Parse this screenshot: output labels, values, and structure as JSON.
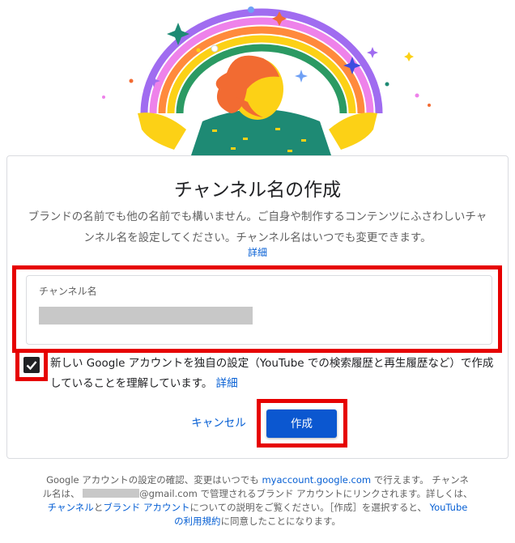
{
  "dialog": {
    "title": "チャンネル名の作成",
    "description": "ブランドの名前でも他の名前でも構いません。ご自身や制作するコンテンツにふさわしいチャンネル名を設定してください。チャンネル名はいつでも変更できます。",
    "learn_more": "詳細",
    "field": {
      "label": "チャンネル名",
      "value": ""
    },
    "checkbox": {
      "checked": true,
      "text": "新しい Google アカウントを独自の設定（YouTube での検索履歴と再生履歴など）で作成していることを理解しています。",
      "link": "詳細"
    },
    "cancel_label": "キャンセル",
    "create_label": "作成"
  },
  "footer": {
    "part1": "Google アカウントの設定の確認、変更はいつでも",
    "link_account": "myaccount.google.com",
    "part2": "で行えます。 チャンネル名は、",
    "email_suffix": "@gmail.com",
    "part3": "で管理されるブランド アカウントにリンクされます。詳しくは、",
    "link_channel": "チャンネル",
    "and": "と",
    "link_brand": "ブランド アカウント",
    "part4": "についての説明をご覧ください。［作成］を選択すると、",
    "link_terms": "YouTube の利用規約",
    "part5": "に同意したことになります。"
  },
  "colors": {
    "accent": "#065fd4",
    "primary_button": "#0b57d0",
    "highlight": "#e60000",
    "rainbow": [
      "#a06cf0",
      "#ee82ea",
      "#ff8a3c",
      "#fcd116",
      "#2b9a63"
    ]
  }
}
